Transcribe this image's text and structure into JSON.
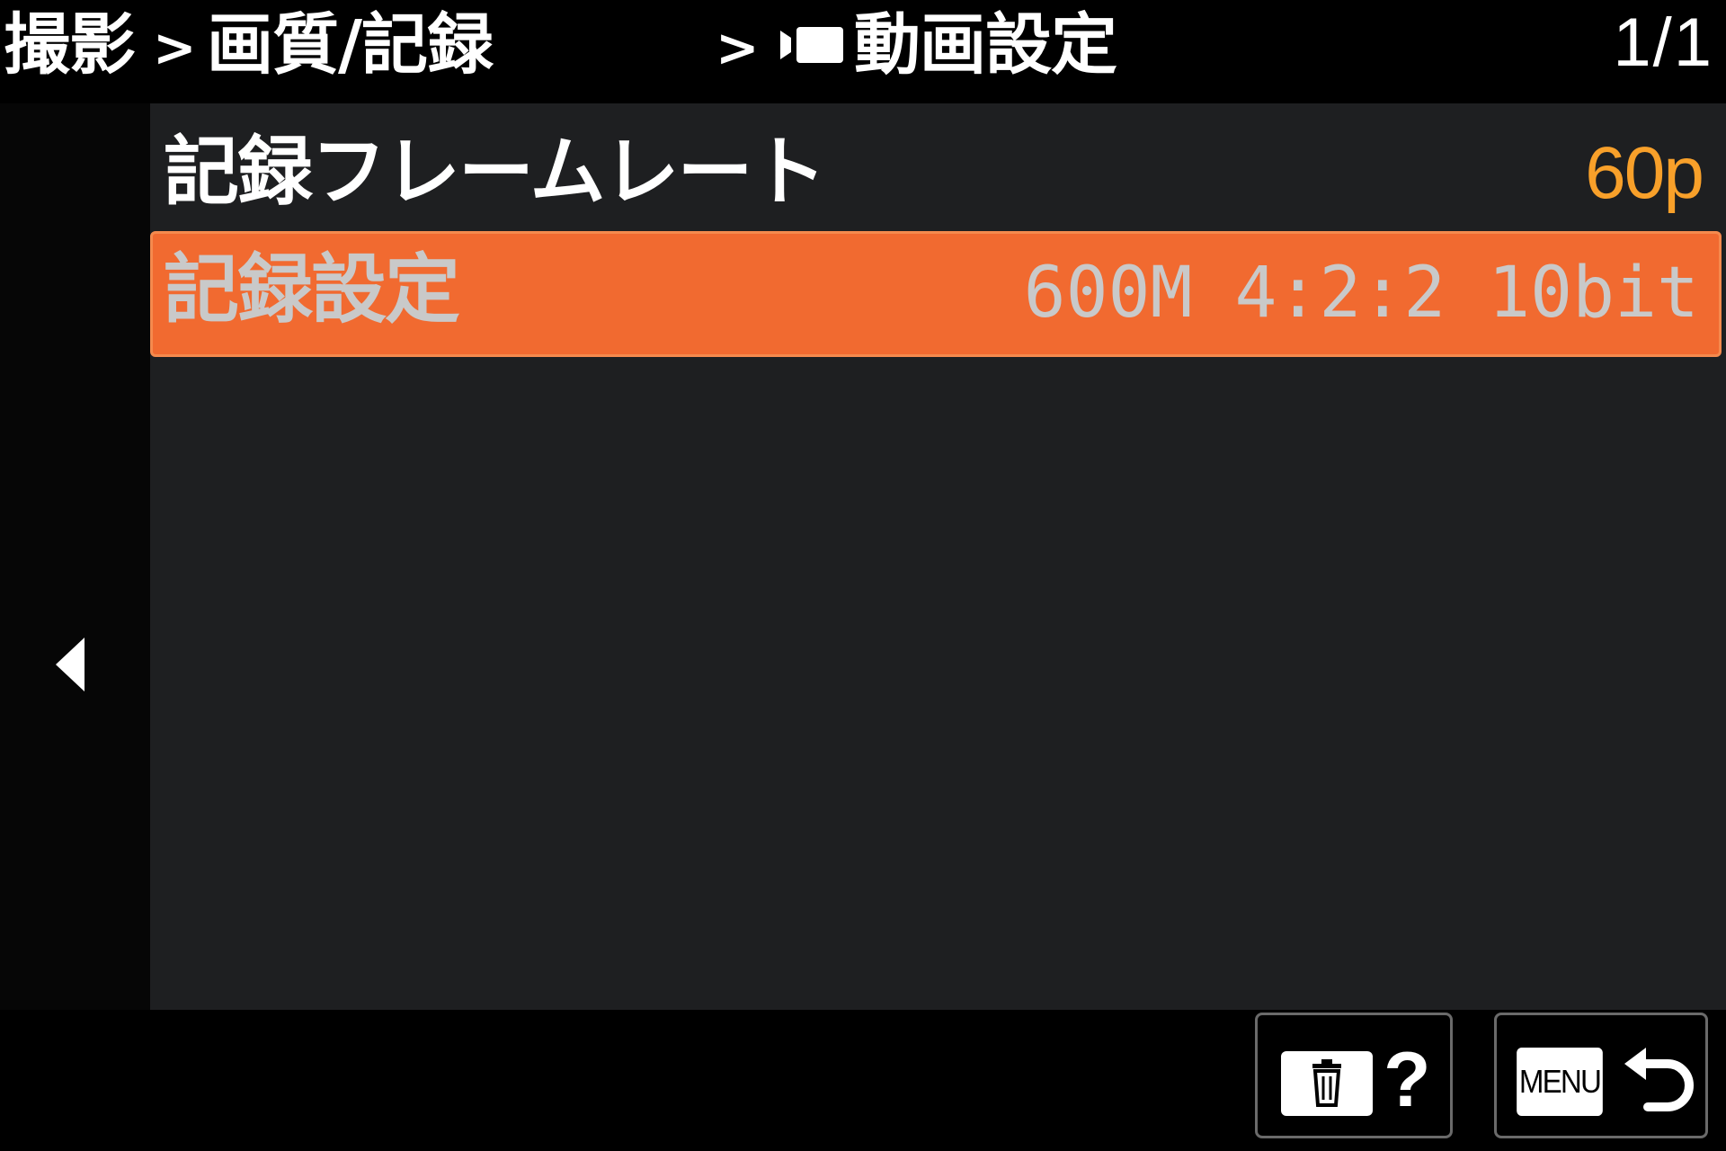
{
  "header": {
    "crumb_1": "撮影",
    "sep_1": ">",
    "crumb_2": "画質/記録",
    "sep_2": ">",
    "crumb_3_icon": "movie-mode-icon",
    "crumb_3": "動画設定",
    "page_indicator": "1/1"
  },
  "menu": {
    "items": [
      {
        "label": "記録フレームレート",
        "value": "60p",
        "selected": false
      },
      {
        "label": "記録設定",
        "value": "600M 4:2:2 10bit",
        "selected": true
      }
    ]
  },
  "footer": {
    "delete_icon": "trash-icon",
    "help_label": "?",
    "menu_label": "MENU",
    "back_icon": "return-arrow-icon"
  },
  "colors": {
    "accent": "#f16a30",
    "value_highlight": "#f8a02a",
    "panel_bg": "#1e1f21",
    "text": "#ffffff"
  }
}
